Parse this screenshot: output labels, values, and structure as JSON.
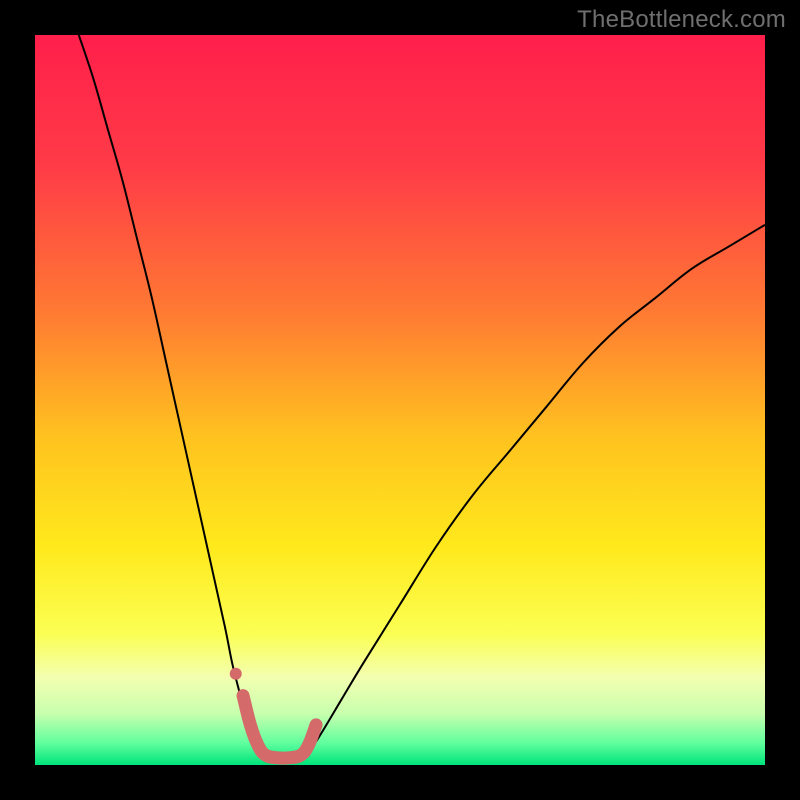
{
  "watermark": "TheBottleneck.com",
  "chart_data": {
    "type": "line",
    "title": "",
    "xlabel": "",
    "ylabel": "",
    "xlim": [
      0,
      100
    ],
    "ylim": [
      0,
      100
    ],
    "gradient_stops": [
      {
        "offset": 0.0,
        "color": "#ff1f4b"
      },
      {
        "offset": 0.18,
        "color": "#ff3b47"
      },
      {
        "offset": 0.38,
        "color": "#ff7a33"
      },
      {
        "offset": 0.55,
        "color": "#ffc21f"
      },
      {
        "offset": 0.7,
        "color": "#ffe91c"
      },
      {
        "offset": 0.82,
        "color": "#fbff53"
      },
      {
        "offset": 0.88,
        "color": "#f3ffb0"
      },
      {
        "offset": 0.93,
        "color": "#c7ffae"
      },
      {
        "offset": 0.97,
        "color": "#60ff9e"
      },
      {
        "offset": 1.0,
        "color": "#00e37a"
      }
    ],
    "series": [
      {
        "name": "left-curve",
        "stroke": "#000000",
        "stroke_width": 2,
        "x": [
          6,
          8,
          10,
          12,
          14,
          16,
          18,
          20,
          22,
          24,
          26,
          27,
          28,
          29,
          30,
          31
        ],
        "y": [
          100,
          94,
          87,
          80,
          72,
          64,
          55,
          46,
          37,
          28,
          19,
          14,
          10,
          6,
          3,
          1
        ]
      },
      {
        "name": "right-curve",
        "stroke": "#000000",
        "stroke_width": 2,
        "x": [
          37,
          39,
          42,
          45,
          50,
          55,
          60,
          65,
          70,
          75,
          80,
          85,
          90,
          95,
          100
        ],
        "y": [
          1,
          4,
          9,
          14,
          22,
          30,
          37,
          43,
          49,
          55,
          60,
          64,
          68,
          71,
          74
        ]
      },
      {
        "name": "highlight-band",
        "stroke": "#d46a6a",
        "stroke_width": 13,
        "linecap": "round",
        "x": [
          28.5,
          29.5,
          30.5,
          31.5,
          33.0,
          35.0,
          36.5,
          37.5,
          38.5
        ],
        "y": [
          9.5,
          5.5,
          2.8,
          1.4,
          1.0,
          1.0,
          1.4,
          2.8,
          5.5
        ]
      }
    ],
    "markers": [
      {
        "name": "dot",
        "x": 27.5,
        "y": 12.5,
        "r": 6,
        "fill": "#d46a6a"
      }
    ]
  }
}
